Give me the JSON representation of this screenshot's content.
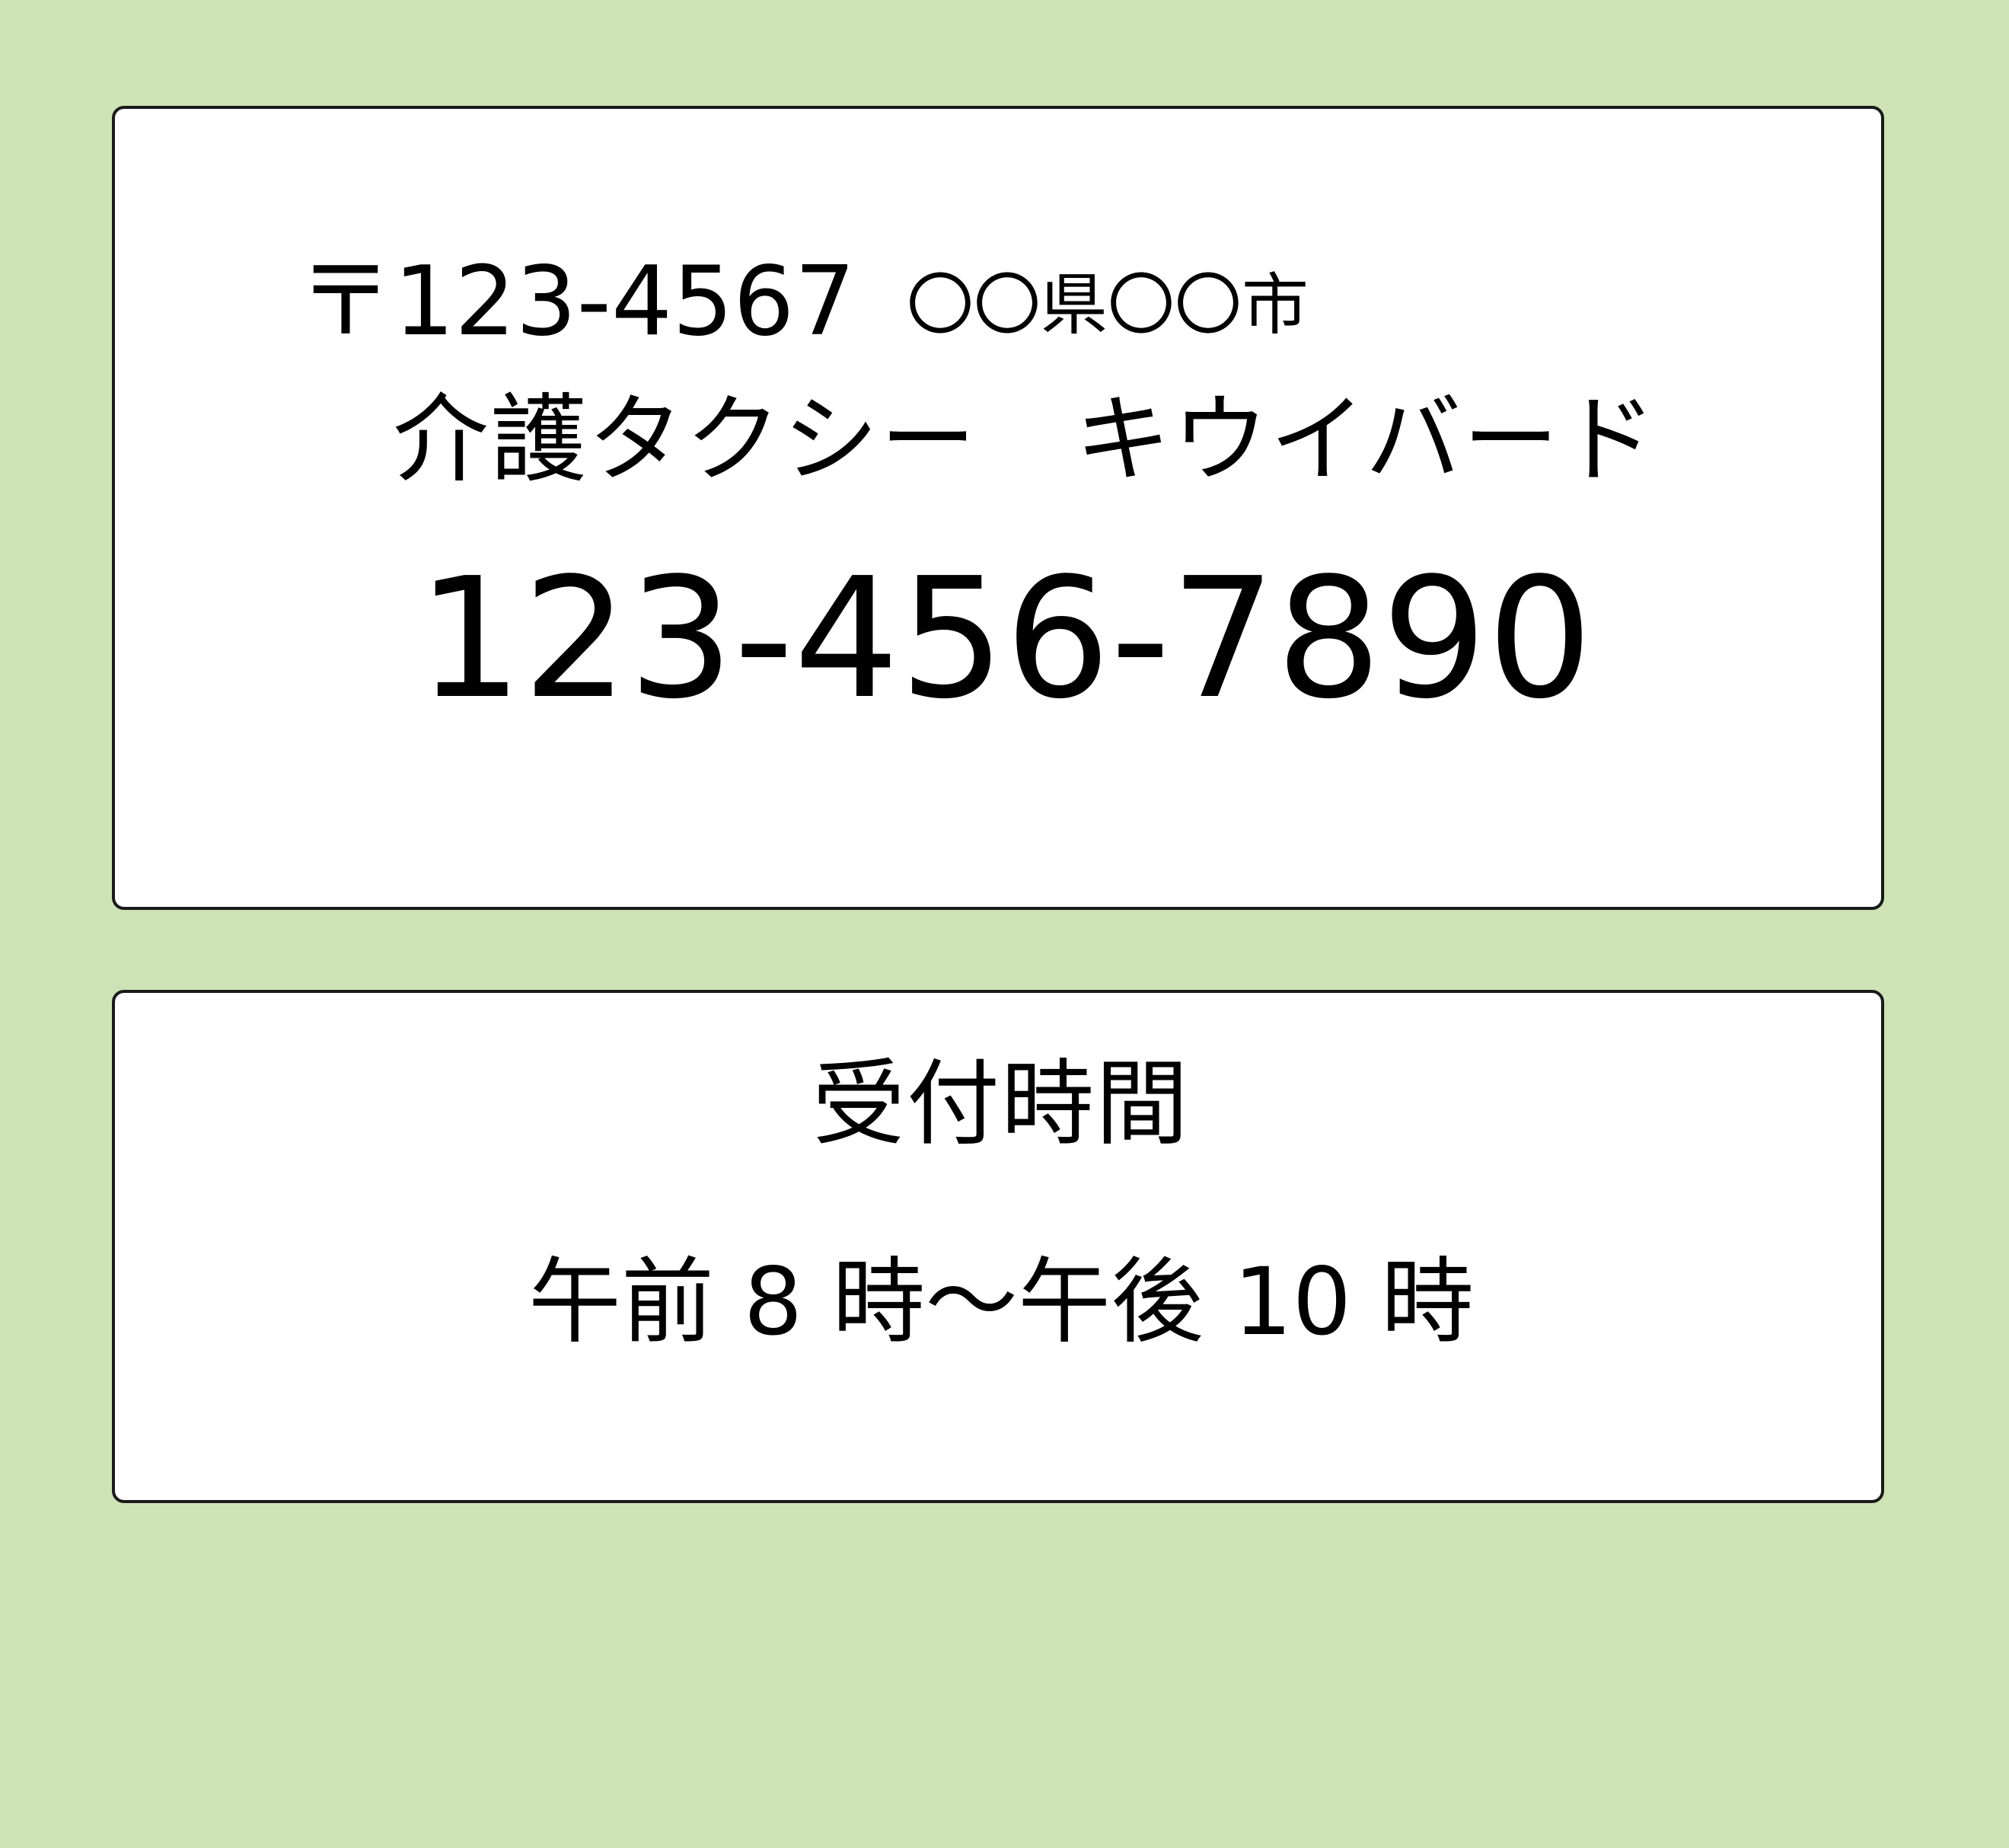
{
  "address": {
    "postal": "〒123-4567",
    "city": "〇〇県〇〇市"
  },
  "company": {
    "name": "介護タクシー　キウイバード"
  },
  "phone": {
    "number": "123-456-7890"
  },
  "hours": {
    "title": "受付時間",
    "value": "午前 8 時〜午後 10 時"
  },
  "colors": {
    "background": "#cde3b6",
    "card": "#ffffff",
    "border": "#1a1a1a"
  }
}
